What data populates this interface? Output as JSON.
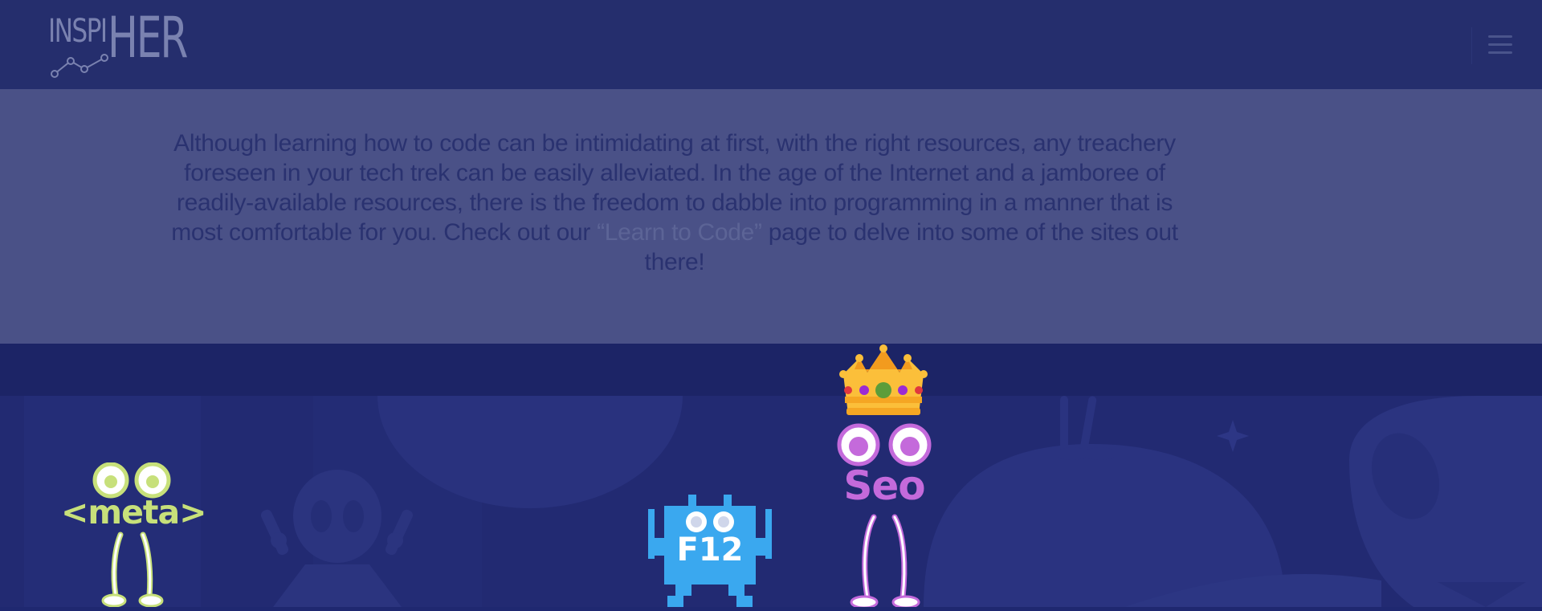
{
  "header": {
    "logo_light": "INSPI",
    "logo_bold": "HER",
    "menu_icon": "hamburger-menu-icon"
  },
  "intro": {
    "before_link": "Although learning how to code can be intimidating at first, with the right resources, any treachery foreseen in your tech trek can be easily alleviated. In the age of the Internet and a jamboree of readily-available resources, there is the freedom to dabble into programming in a manner that is most comfortable for you. Check out our ",
    "link_text": "“Learn to Code”",
    "after_link": " page to delve into some of the sites out there!"
  },
  "mascots": {
    "meta": "<meta>",
    "f12": "F12",
    "seo": "Seo"
  },
  "colors": {
    "header_bg": "#252e6d",
    "band_bg": "#4a5187",
    "stage_bg": "#1f2870",
    "meta_green": "#c7e07a",
    "f12_blue": "#3aa8ef",
    "seo_purple": "#c46adb",
    "crown_gold": "#fbbf3a"
  }
}
